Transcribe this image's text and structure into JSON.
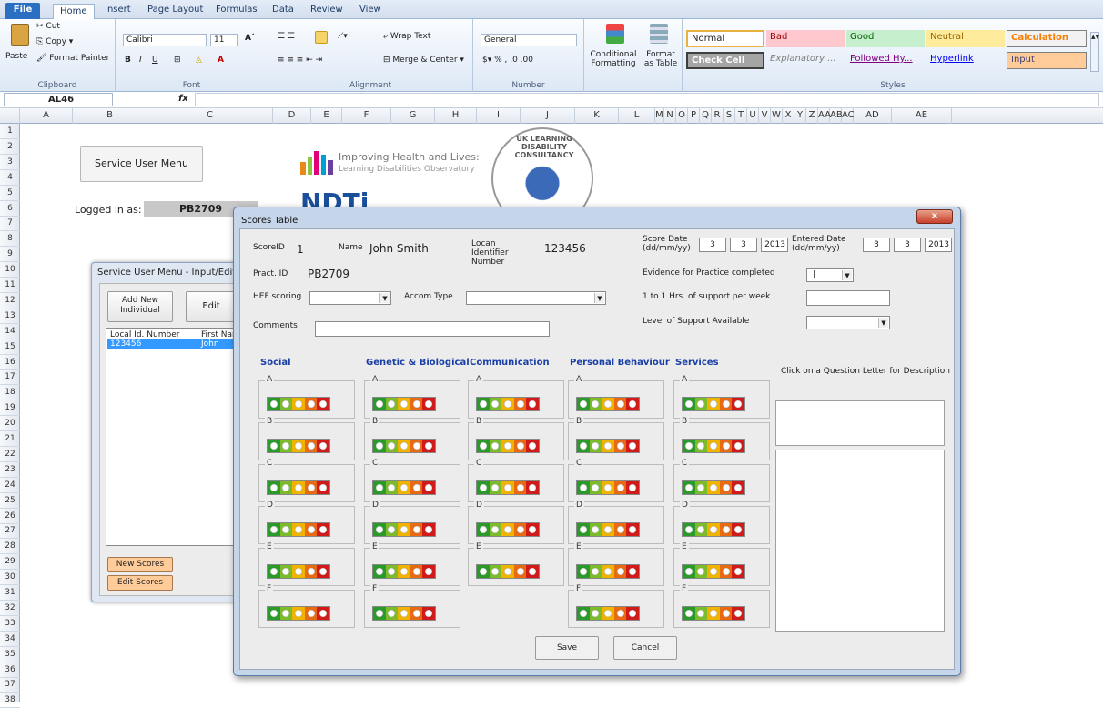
{
  "ribbon": {
    "tabs": [
      "File",
      "Home",
      "Insert",
      "Page Layout",
      "Formulas",
      "Data",
      "Review",
      "View"
    ],
    "clipboard": {
      "cut": "Cut",
      "copy": "Copy",
      "paste": "Paste",
      "format_painter": "Format Painter",
      "label": "Clipboard"
    },
    "font": {
      "name": "Calibri",
      "size": "11",
      "label": "Font"
    },
    "alignment": {
      "wrap": "Wrap Text",
      "merge": "Merge & Center",
      "label": "Alignment"
    },
    "number": {
      "format": "General",
      "label": "Number"
    },
    "cond_format": "Conditional Formatting",
    "format_table": "Format as Table",
    "styles": {
      "label": "Styles",
      "normal": "Normal",
      "bad": "Bad",
      "good": "Good",
      "neutral": "Neutral",
      "calculation": "Calculation",
      "check_cell": "Check Cell",
      "explanatory": "Explanatory ...",
      "followed": "Followed Hy...",
      "hyperlink": "Hyperlink",
      "input": "Input"
    }
  },
  "formula_bar": {
    "name_box": "AL46",
    "fx": "fx",
    "value": ""
  },
  "columns": [
    "A",
    "B",
    "C",
    "D",
    "E",
    "F",
    "G",
    "H",
    "I",
    "J",
    "K",
    "L",
    "M",
    "N",
    "O",
    "P",
    "Q",
    "R",
    "S",
    "T",
    "U",
    "V",
    "W",
    "X",
    "Y",
    "Z",
    "AA",
    "AB",
    "AC",
    "AD",
    "AE"
  ],
  "rows": [
    "1",
    "2",
    "3",
    "4",
    "5",
    "6",
    "7",
    "8",
    "9",
    "10",
    "11",
    "12",
    "13",
    "14",
    "15",
    "16",
    "17",
    "18",
    "19",
    "20",
    "21",
    "22",
    "23",
    "24",
    "25",
    "26",
    "27",
    "28",
    "29",
    "30",
    "31",
    "32",
    "33",
    "34",
    "35",
    "36",
    "37",
    "38"
  ],
  "sheet": {
    "service_menu_button": "Service User Menu",
    "logged_in_label": "Logged in as:",
    "logged_in_value": "PB2709",
    "logo1_title": "Improving Health and Lives:",
    "logo1_sub": "Learning Disabilities Observatory",
    "ndti": "NDTi",
    "ukld": "UK LEARNING DISABILITY CONSULTANCY"
  },
  "bg_form": {
    "title": "Service User Menu - Input/Edit Da",
    "add_new": "Add New Individual",
    "edit": "Edit",
    "list_headers": [
      "Local Id. Number",
      "First Nam"
    ],
    "list_row": [
      "123456",
      "John"
    ],
    "new_scores": "New Scores",
    "edit_scores": "Edit Scores"
  },
  "dialog": {
    "title": "Scores Table",
    "close": "x",
    "score_id_label": "ScoreID",
    "score_id": "1",
    "name_label": "Name",
    "name": "John Smith",
    "locan_label": "Locan Identifier Number",
    "locan": "123456",
    "score_date_label": "Score Date (dd/mm/yy)",
    "score_date": [
      "3",
      "3",
      "2013"
    ],
    "entered_date_label": "Entered Date (dd/mm/yy)",
    "entered_date": [
      "3",
      "3",
      "2013"
    ],
    "pract_label": "Pract. ID",
    "pract": "PB2709",
    "evidence_label": "Evidence for Practice completed",
    "evidence_value": "|",
    "hef_label": "HEF scoring",
    "accom_label": "Accom Type",
    "one_to_one_label": "1 to 1 Hrs. of support per week",
    "comments_label": "Comments",
    "level_label": "Level of Support Available",
    "description_hint": "Click on a Question Letter for Description",
    "save": "Save",
    "cancel": "Cancel",
    "categories": [
      {
        "name": "Social",
        "letters": [
          "A",
          "B",
          "C",
          "D",
          "E",
          "F"
        ]
      },
      {
        "name": "Genetic & Biological",
        "letters": [
          "A",
          "B",
          "C",
          "D",
          "E",
          "F"
        ]
      },
      {
        "name": "Communication",
        "letters": [
          "A",
          "B",
          "C",
          "D",
          "E"
        ]
      },
      {
        "name": "Personal Behaviour",
        "letters": [
          "A",
          "B",
          "C",
          "D",
          "E",
          "F"
        ]
      },
      {
        "name": "Services",
        "letters": [
          "A",
          "B",
          "C",
          "D",
          "E",
          "F"
        ]
      }
    ],
    "scale_colors": [
      "#2a9a2a",
      "#7cbc2a",
      "#f0b400",
      "#e86a12",
      "#d11a1a"
    ]
  }
}
